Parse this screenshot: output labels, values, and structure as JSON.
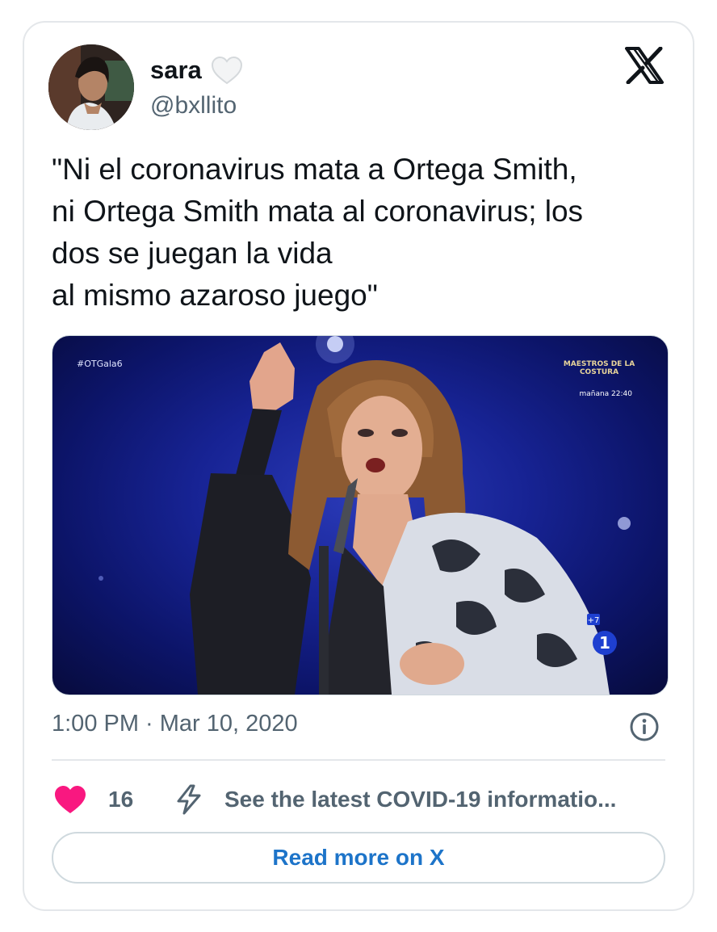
{
  "author": {
    "display_name": "sara",
    "handle": "@bxllito",
    "name_emoji_icon": "white-heart-icon"
  },
  "brand": {
    "logo_icon": "x-logo-icon"
  },
  "tweet": {
    "text": "\"Ni el coronavirus mata a Ortega Smith,\nni Ortega Smith mata al coronavirus; los\ndos se juegan la vida\nal mismo azaroso juego\"",
    "timestamp": "1:00 PM · Mar 10, 2020"
  },
  "media": {
    "overlay_hashtag": "#OTGala6",
    "show_badge": "MAESTROS DE LA COSTURA",
    "show_time": "mañana 22:40",
    "channel_plus": "+7",
    "channel_number": "1"
  },
  "actions": {
    "like_count": "16",
    "covid_info": "See the latest COVID-19 informatio...",
    "read_more": "Read more on X"
  },
  "colors": {
    "like": "#f91880",
    "link": "#1d74c9",
    "secondary_text": "#536471",
    "border": "#cfd9de"
  }
}
